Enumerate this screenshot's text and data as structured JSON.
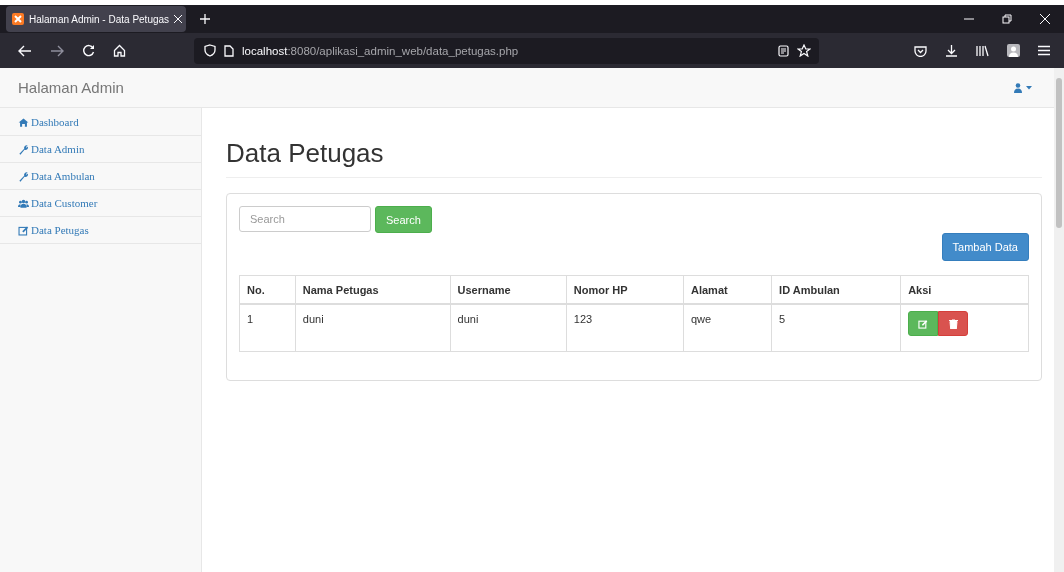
{
  "browser": {
    "tab_title": "Halaman Admin - Data Petugas",
    "url_host": "localhost",
    "url_path": ":8080/aplikasi_admin_web/data_petugas.php"
  },
  "navbar": {
    "brand": "Halaman Admin"
  },
  "sidebar": {
    "items": [
      {
        "label": "Dashboard",
        "kind": "home"
      },
      {
        "label": "Data Admin",
        "kind": "wrench"
      },
      {
        "label": "Data Ambulan",
        "kind": "wrench"
      },
      {
        "label": "Data Customer",
        "kind": "users"
      },
      {
        "label": "Data Petugas",
        "kind": "edit"
      }
    ]
  },
  "page": {
    "title": "Data Petugas",
    "search": {
      "placeholder": "Search",
      "button": "Search"
    },
    "add_button": "Tambah Data"
  },
  "table": {
    "columns": [
      "No.",
      "Nama Petugas",
      "Username",
      "Nomor HP",
      "Alamat",
      "ID Ambulan",
      "Aksi"
    ],
    "rows": [
      {
        "cells": [
          "1",
          "duni",
          "duni",
          "123",
          "qwe",
          "5"
        ]
      }
    ]
  }
}
